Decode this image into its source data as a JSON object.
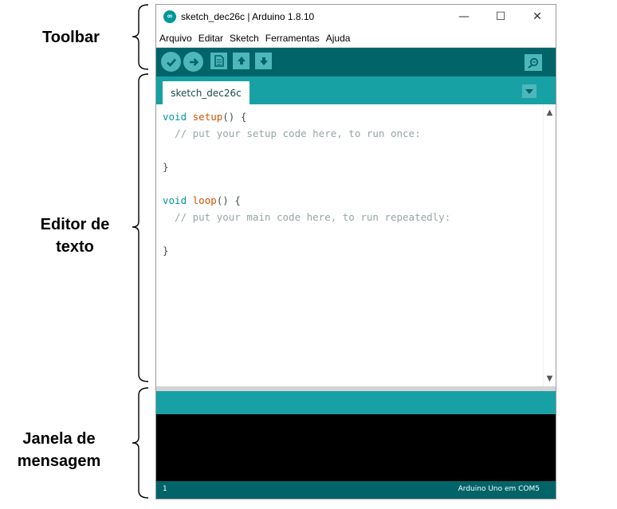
{
  "annotations": {
    "toolbar": "Toolbar",
    "editor_line1": "Editor de",
    "editor_line2": "texto",
    "console_line1": "Janela de",
    "console_line2": "mensagem"
  },
  "window": {
    "title": "sketch_dec26c | Arduino 1.8.10",
    "logo_glyph": "∞",
    "controls": {
      "minimize": "—",
      "maximize": "☐",
      "close": "✕"
    }
  },
  "menu": [
    "Arquivo",
    "Editar",
    "Sketch",
    "Ferramentas",
    "Ajuda"
  ],
  "toolbar": {
    "buttons": [
      "verify-icon",
      "upload-icon",
      "new-icon",
      "open-icon",
      "save-icon"
    ],
    "serial_monitor": "magnifier-icon"
  },
  "tabs": [
    {
      "label": "sketch_dec26c"
    }
  ],
  "editor": {
    "code": [
      "void setup() {",
      "  // put your setup code here, to run once:",
      "",
      "}",
      "",
      "void loop() {",
      "  // put your main code here, to run repeatedly:",
      "",
      "}"
    ],
    "scroll_up": "▲",
    "scroll_down": "▼"
  },
  "status": {
    "line_number": "1",
    "board": "Arduino Uno em COM5"
  },
  "colors": {
    "teal_dark": "#006468",
    "teal_mid": "#17a1a5",
    "teal_button": "#4db7bb",
    "keyword": "#00979c",
    "function": "#d35400",
    "comment": "#95a5a6"
  }
}
